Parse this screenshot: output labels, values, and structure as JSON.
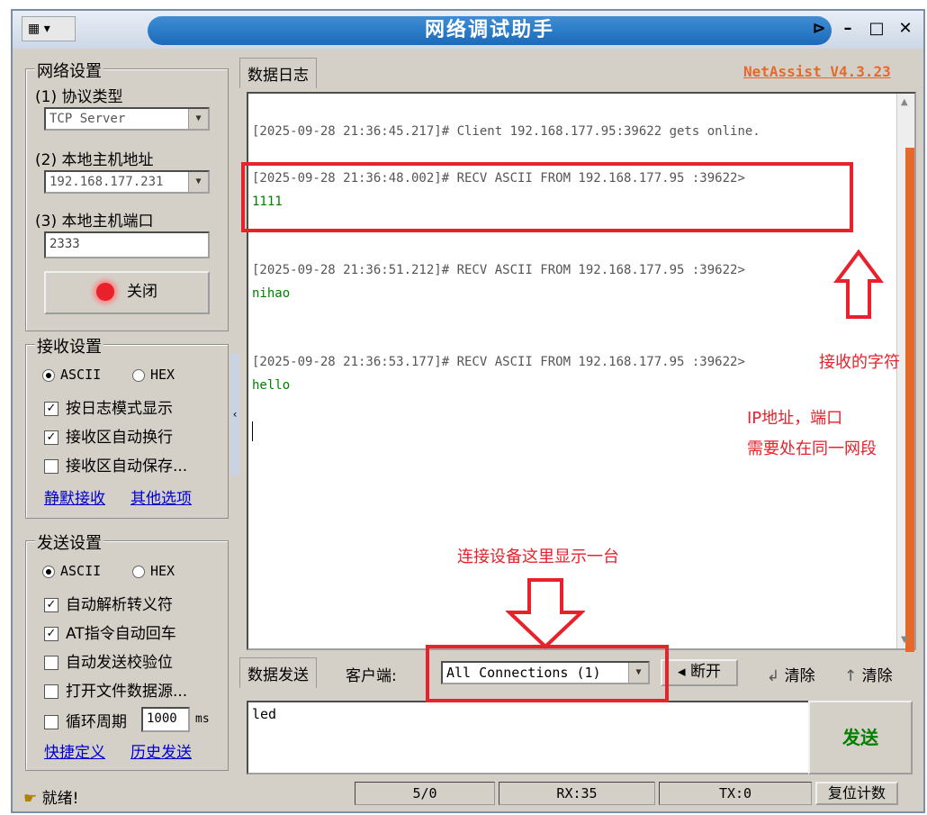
{
  "window": {
    "title": "网络调试助手",
    "version_link": "NetAssist V4.3.23",
    "sysmenu_icon": "app-icon",
    "controls": [
      "pin",
      "minimize",
      "maximize",
      "close"
    ]
  },
  "network_settings": {
    "title": "网络设置",
    "protocol_label": "(1) 协议类型",
    "protocol_value": "TCP Server",
    "host_label": "(2) 本地主机地址",
    "host_value": "192.168.177.231",
    "port_label": "(3) 本地主机端口",
    "port_value": "2333",
    "toggle_button": "关闭"
  },
  "receive_settings": {
    "title": "接收设置",
    "ascii_label": "ASCII",
    "hex_label": "HEX",
    "mode_selected": "ASCII",
    "options": [
      {
        "label": "按日志模式显示",
        "checked": true
      },
      {
        "label": "接收区自动换行",
        "checked": true
      },
      {
        "label": "接收区自动保存...",
        "checked": false
      }
    ],
    "link_silent": "静默接收",
    "link_other": "其他选项"
  },
  "send_settings": {
    "title": "发送设置",
    "ascii_label": "ASCII",
    "hex_label": "HEX",
    "mode_selected": "ASCII",
    "options": [
      {
        "label": "自动解析转义符",
        "checked": true
      },
      {
        "label": "AT指令自动回车",
        "checked": true
      },
      {
        "label": "自动发送校验位",
        "checked": false
      },
      {
        "label": "打开文件数据源...",
        "checked": false
      }
    ],
    "loop_label": "循环周期",
    "loop_value": "1000",
    "loop_unit": "ms",
    "loop_checked": false,
    "link_shortcut": "快捷定义",
    "link_history": "历史发送"
  },
  "log": {
    "tab": "数据日志",
    "entries": [
      {
        "header": "[2025-09-28 21:36:45.217]# Client 192.168.177.95:39622 gets online.",
        "data": ""
      },
      {
        "header": "[2025-09-28 21:36:48.002]# RECV ASCII FROM 192.168.177.95 :39622>",
        "data": "1111"
      },
      {
        "header": "[2025-09-28 21:36:51.212]# RECV ASCII FROM 192.168.177.95 :39622>",
        "data": "nihao"
      },
      {
        "header": "[2025-09-28 21:36:53.177]# RECV ASCII FROM 192.168.177.95 :39622>",
        "data": "hello"
      }
    ]
  },
  "annotations": {
    "received_chars": "接收的字符",
    "ip_note_line1": "IP地址，端口",
    "ip_note_line2": "需要处在同一网段",
    "connection_note": "连接设备这里显示一台",
    "color": "#e8212b"
  },
  "send": {
    "tab": "数据发送",
    "client_label": "客户端:",
    "client_value": "All Connections (1)",
    "disconnect": "断开",
    "clear1": "清除",
    "clear2": "清除",
    "input_value": "led",
    "send_button": "发送"
  },
  "status": {
    "ready": "就绪!",
    "counter": "5/0",
    "rx": "RX:35",
    "tx": "TX:0",
    "reset": "复位计数"
  }
}
